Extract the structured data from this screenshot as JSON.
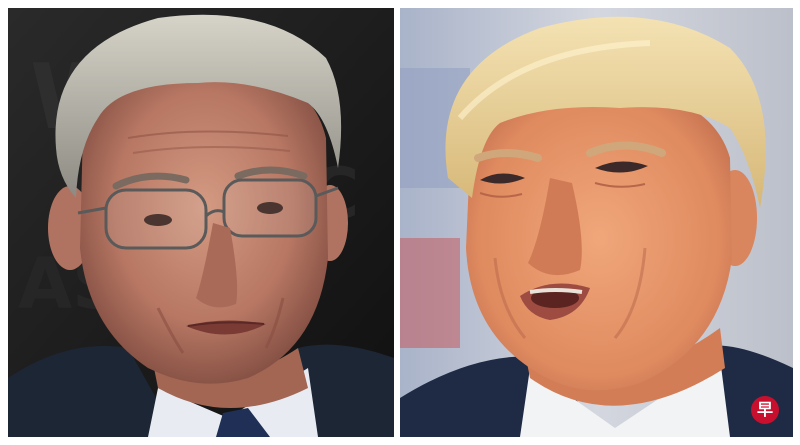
{
  "watermark": {
    "text": "早",
    "color": "#c8102e"
  },
  "colors": {
    "left_background": "#141414",
    "right_background": "#c7cbd6",
    "suit_dark": "#1f2b45"
  }
}
